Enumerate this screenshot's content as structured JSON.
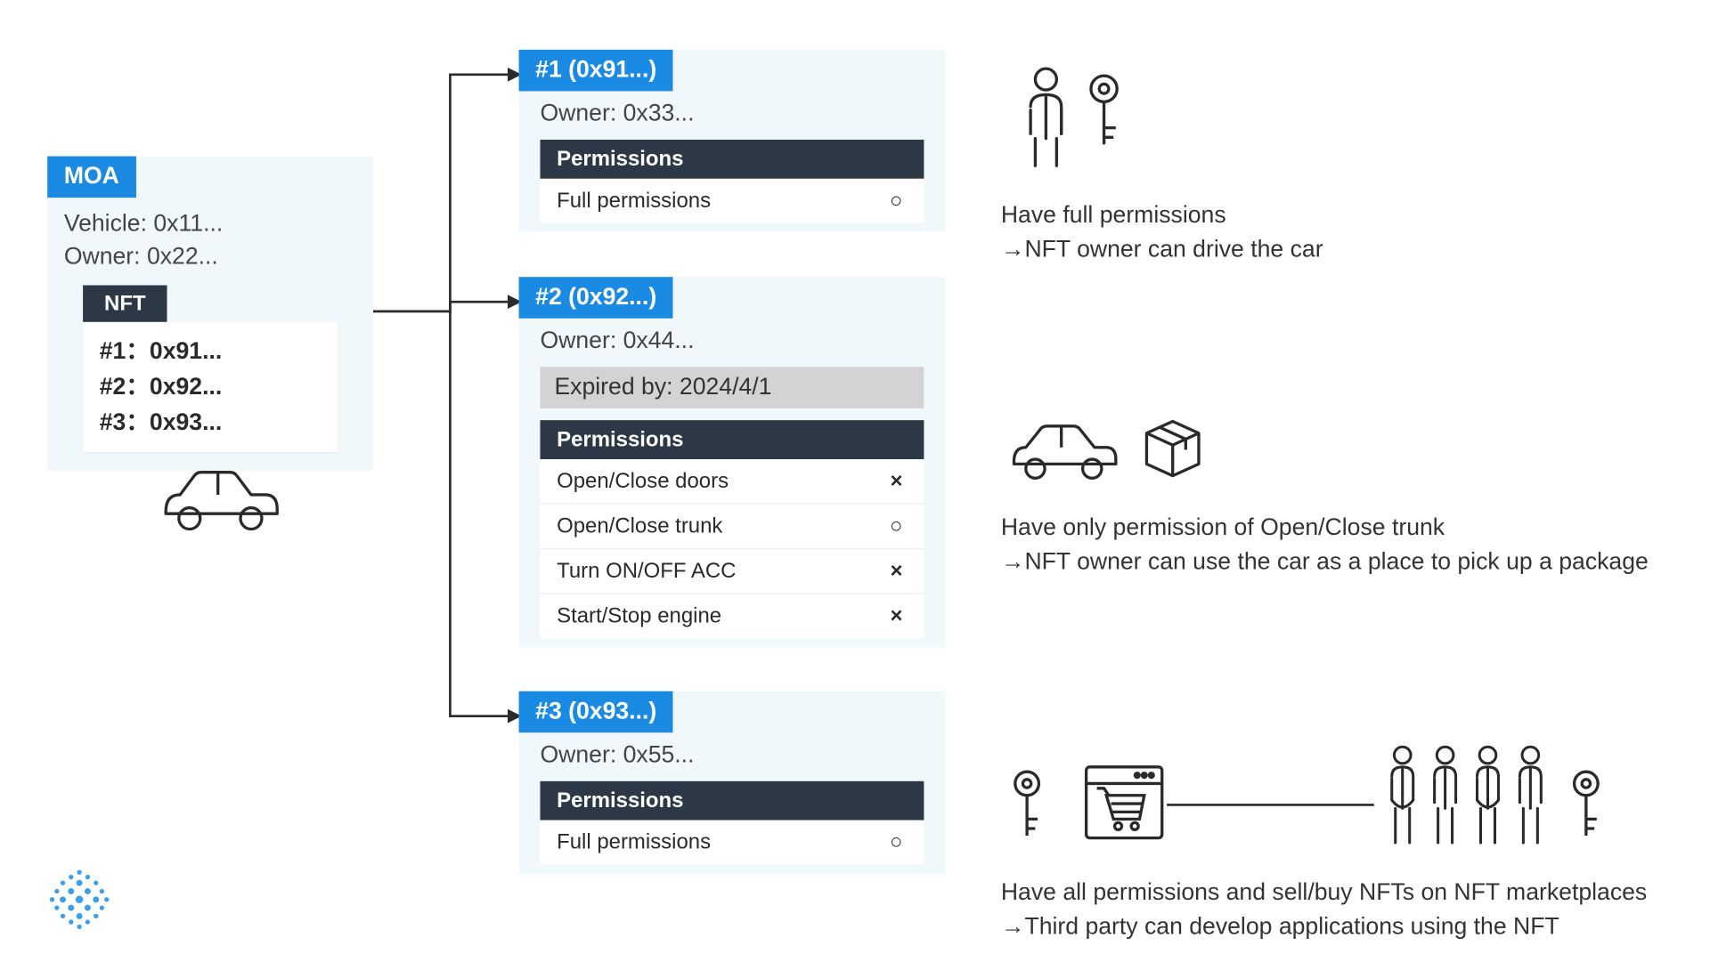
{
  "moa": {
    "title": "MOA",
    "vehicle": "Vehicle: 0x11...",
    "owner": "Owner: 0x22...",
    "nft_tab": "NFT",
    "nft_entries": [
      "#1：0x91...",
      "#2：0x92...",
      "#3：0x93..."
    ]
  },
  "nft": [
    {
      "title": "#1 (0x91...)",
      "owner": "Owner: 0x33...",
      "perm_head": "Permissions",
      "perms": [
        {
          "label": "Full permissions",
          "mark": "○"
        }
      ]
    },
    {
      "title": "#2 (0x92...)",
      "owner": "Owner: 0x44...",
      "expired": "Expired by: 2024/4/1",
      "perm_head": "Permissions",
      "perms": [
        {
          "label": "Open/Close doors",
          "mark": "×"
        },
        {
          "label": "Open/Close trunk",
          "mark": "○"
        },
        {
          "label": "Turn ON/OFF ACC",
          "mark": "×"
        },
        {
          "label": "Start/Stop engine",
          "mark": "×"
        }
      ]
    },
    {
      "title": "#3 (0x93...)",
      "owner": "Owner: 0x55...",
      "perm_head": "Permissions",
      "perms": [
        {
          "label": "Full permissions",
          "mark": "○"
        }
      ]
    }
  ],
  "annotations": {
    "a1_line1": "Have full permissions",
    "a1_line2": "→NFT owner can drive the car",
    "a2_line1": "Have only permission of Open/Close trunk",
    "a2_line2": "→NFT owner can use the car as a place to pick up a package",
    "a3_line1": "Have all permissions and sell/buy NFTs on NFT marketplaces",
    "a3_line2": "→Third party can develop applications using the NFT"
  }
}
